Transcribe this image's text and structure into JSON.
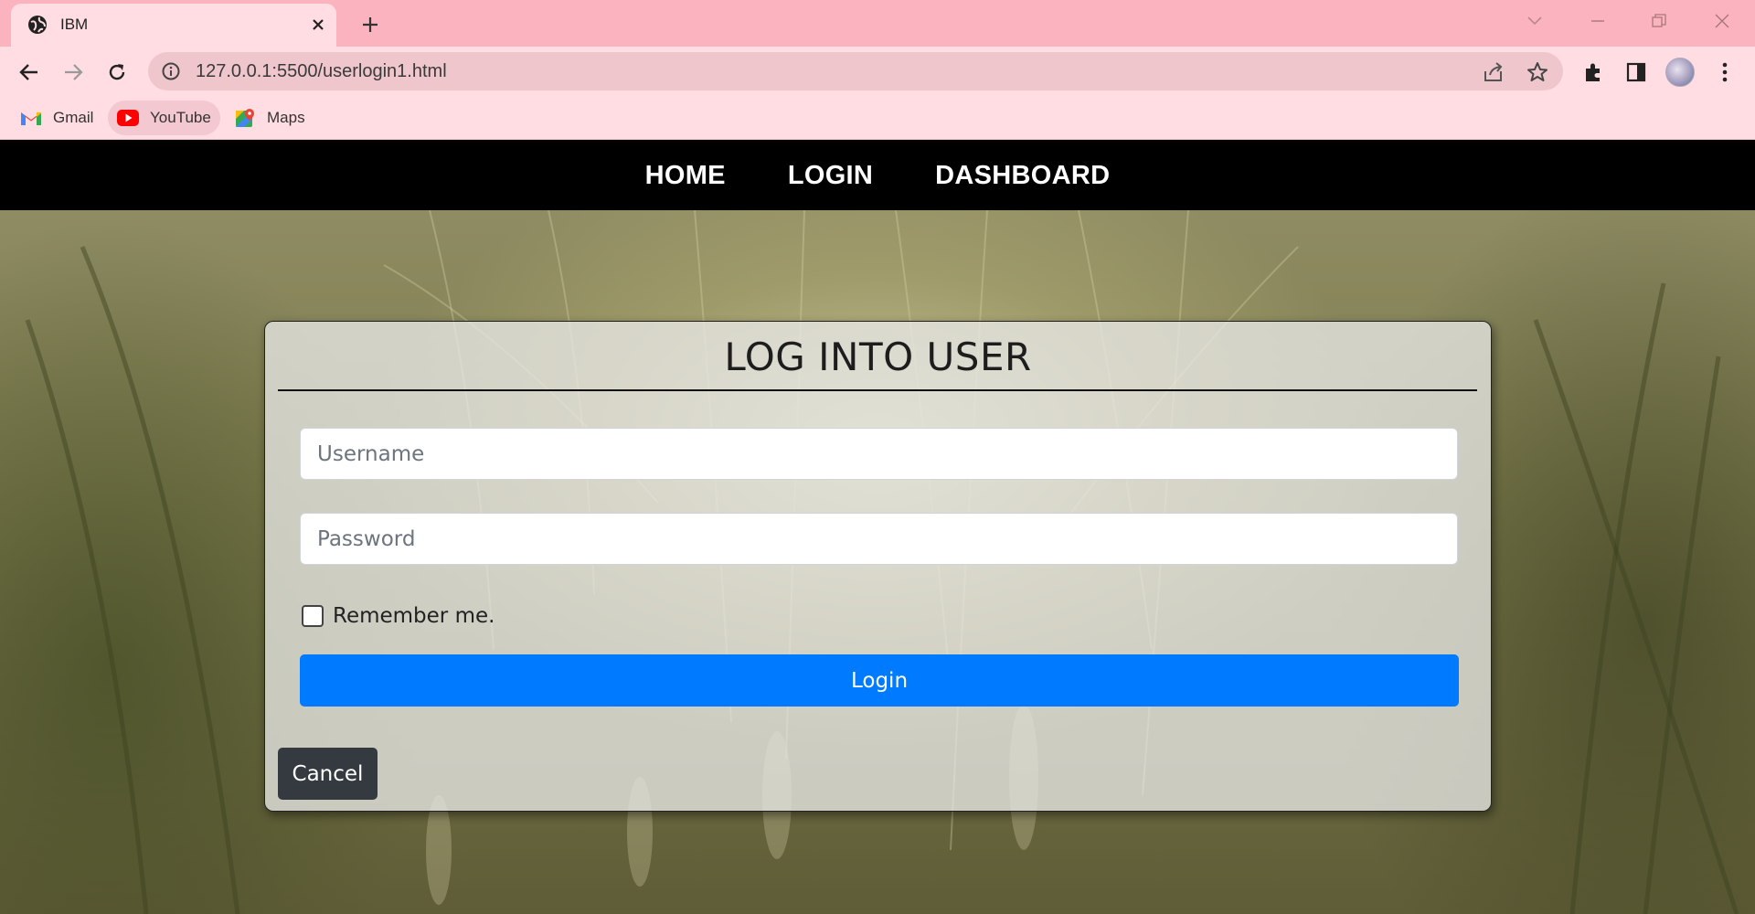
{
  "browser": {
    "tab_title": "IBM",
    "url": "127.0.0.1:5500/userlogin1.html",
    "bookmarks": [
      {
        "label": "Gmail",
        "icon": "gmail-icon"
      },
      {
        "label": "YouTube",
        "icon": "youtube-icon"
      },
      {
        "label": "Maps",
        "icon": "maps-icon"
      }
    ],
    "colors": {
      "tabstrip": "#fcb3c0",
      "toolbar": "#ffdde3",
      "omnibox": "#f0c6cd"
    }
  },
  "site_nav": {
    "links": [
      {
        "label": "HOME"
      },
      {
        "label": "LOGIN"
      },
      {
        "label": "DASHBOARD"
      }
    ]
  },
  "login_card": {
    "title": "LOG INTO USER",
    "username_placeholder": "Username",
    "password_placeholder": "Password",
    "remember_label": "Remember me.",
    "remember_checked": false,
    "login_label": "Login",
    "cancel_label": "Cancel",
    "colors": {
      "login_button": "#007bff",
      "cancel_button": "#343a40"
    }
  }
}
